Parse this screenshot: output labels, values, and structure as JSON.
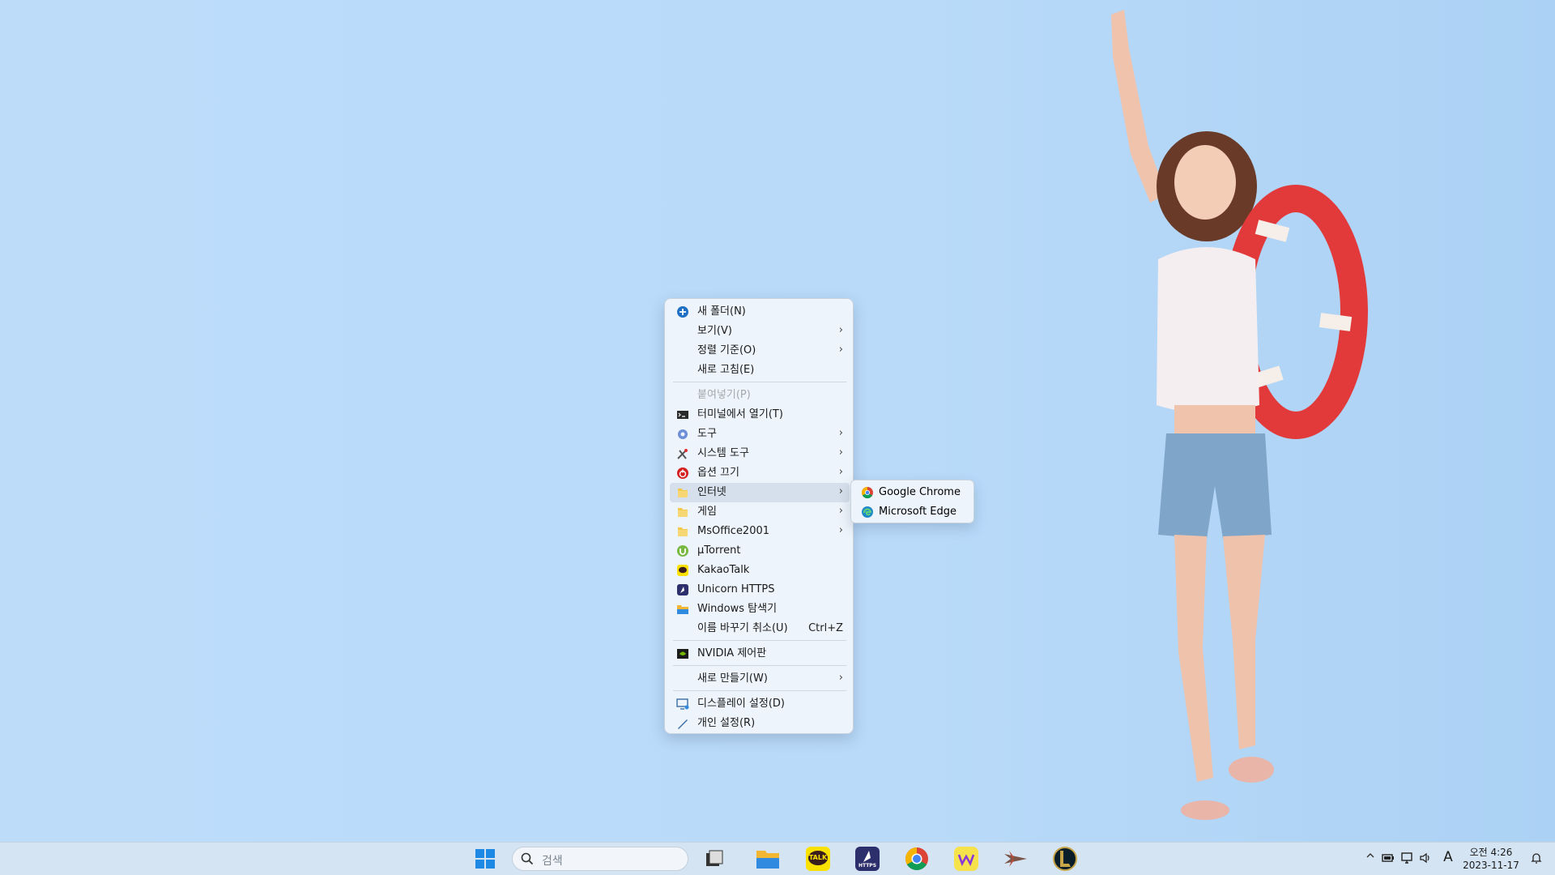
{
  "context_menu": {
    "items": [
      {
        "label": "새 폴더(N)",
        "icon": "new-folder-icon"
      },
      {
        "label": "보기(V)",
        "submenu": true
      },
      {
        "label": "정렬 기준(O)",
        "submenu": true
      },
      {
        "label": "새로 고침(E)"
      },
      {
        "label": "붙여넣기(P)",
        "disabled": true
      },
      {
        "label": "터미널에서 열기(T)",
        "icon": "terminal-icon"
      },
      {
        "label": "도구",
        "icon": "tools-icon",
        "submenu": true
      },
      {
        "label": "시스템 도구",
        "icon": "system-tools-icon",
        "submenu": true
      },
      {
        "label": "옵션 끄기",
        "icon": "power-icon",
        "submenu": true
      },
      {
        "label": "인터넷",
        "icon": "folder-icon",
        "submenu": true
      },
      {
        "label": "게임",
        "icon": "folder-icon",
        "submenu": true
      },
      {
        "label": "MsOffice2001",
        "icon": "folder-icon",
        "submenu": true
      },
      {
        "label": "µTorrent",
        "icon": "utorrent-icon"
      },
      {
        "label": "KakaoTalk",
        "icon": "kakaotalk-icon"
      },
      {
        "label": "Unicorn HTTPS",
        "icon": "unicorn-https-icon"
      },
      {
        "label": "Windows 탐색기",
        "icon": "file-explorer-icon"
      },
      {
        "label": "이름 바꾸기 취소(U)",
        "shortcut": "Ctrl+Z"
      },
      {
        "label": "NVIDIA 제어판",
        "icon": "nvidia-icon"
      },
      {
        "label": "새로 만들기(W)",
        "submenu": true
      },
      {
        "label": "디스플레이 설정(D)",
        "icon": "display-settings-icon"
      },
      {
        "label": "개인 설정(R)",
        "icon": "personalize-icon"
      }
    ],
    "arrow_glyph": "›"
  },
  "submenu_internet": {
    "items": [
      {
        "label": "Google Chrome",
        "icon": "chrome-icon"
      },
      {
        "label": "Microsoft Edge",
        "icon": "edge-icon"
      }
    ]
  },
  "taskbar": {
    "search_placeholder": "검색",
    "apps": [
      "start-icon",
      "task-view-icon",
      "file-explorer-icon",
      "kakaotalk-icon",
      "unicorn-https-icon",
      "chrome-icon",
      "app-w-icon",
      "game-plane-icon",
      "league-of-legends-icon"
    ],
    "kakao_label": "TALK",
    "https_label": "HTTPS",
    "ime": "A",
    "time": "오전 4:26",
    "date": "2023-11-17"
  },
  "colors": {
    "accent": "#0067c0",
    "highlight": "#d6e0ec"
  }
}
